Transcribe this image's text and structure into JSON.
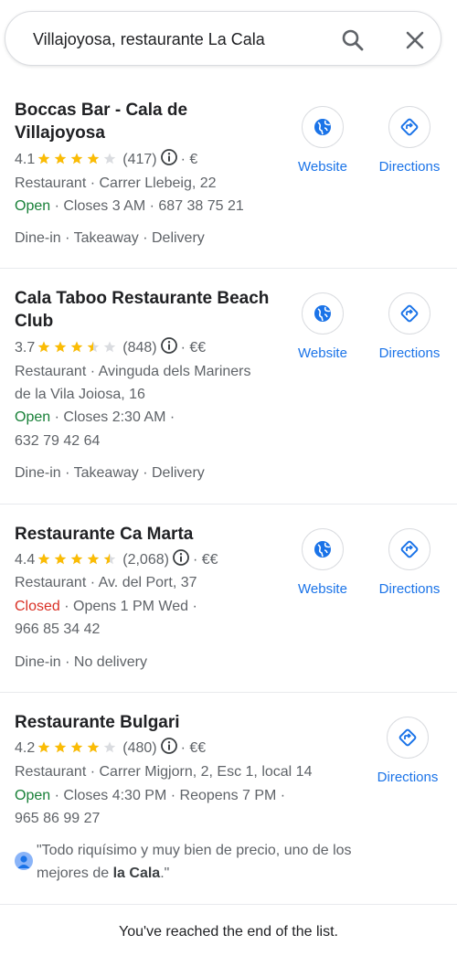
{
  "search": {
    "value": "Villajoyosa, restaurante La Cala"
  },
  "results": [
    {
      "title_line1": "Boccas Bar - Cala de",
      "title_line2": "Villajoyosa",
      "rating": "4.1",
      "stars": 4.1,
      "count": "(417)",
      "price": "· €",
      "address": "Restaurant · Carrer Llebeig, 22",
      "status": "Open",
      "hours": " · Closes 3 AM · 687 38 75 21",
      "hours2": "",
      "services": "Dine-in · Takeaway · Delivery",
      "website_label": "Website",
      "directions_label": "Directions"
    },
    {
      "title_line1": "Cala Taboo Restaurante Beach",
      "title_line2": "Club",
      "rating": "3.7",
      "stars": 3.7,
      "count": "(848)",
      "price": "· €€",
      "address": "Restaurant · Avinguda dels Mariners",
      "address2": "de la Vila Joiosa, 16",
      "status": "Open",
      "hours": " · Closes 2:30 AM ·",
      "hours2": "632 79 42 64",
      "services": "Dine-in · Takeaway · Delivery",
      "website_label": "Website",
      "directions_label": "Directions"
    },
    {
      "title_line1": "Restaurante Ca Marta",
      "rating": "4.4",
      "stars": 4.4,
      "count": "(2,068)",
      "price": "· €€",
      "address": "Restaurant · Av. del Port, 37",
      "status": "Closed",
      "hours": " · Opens 1 PM Wed ·",
      "hours2": "966 85 34 42",
      "services": "Dine-in · No delivery",
      "website_label": "Website",
      "directions_label": "Directions"
    },
    {
      "title_line1": "Restaurante Bulgari",
      "rating": "4.2",
      "stars": 4.2,
      "count": "(480)",
      "price": "· €€",
      "address": "Restaurant · Carrer Migjorn, 2, Esc 1, local 14",
      "status": "Open",
      "hours": " · Closes 4:30 PM · Reopens 7 PM ·",
      "hours2": "965 86 99 27",
      "review_line1": "\"Todo riquísimo y muy bien de precio, uno de los",
      "review_line2_pre": "mejores de ",
      "review_line2_bold": "la Cala",
      "review_line2_post": ".\"",
      "directions_label": "Directions"
    }
  ],
  "end_message": "You've reached the end of the list.",
  "colors": {
    "accent": "#1a73e8",
    "star": "#fbbc04",
    "open": "#188038",
    "closed": "#d93025"
  },
  "icons": {
    "search": "search-icon",
    "close": "close-icon",
    "website": "globe-icon",
    "directions": "directions-icon",
    "info": "info-icon",
    "avatar": "user-avatar-icon"
  }
}
